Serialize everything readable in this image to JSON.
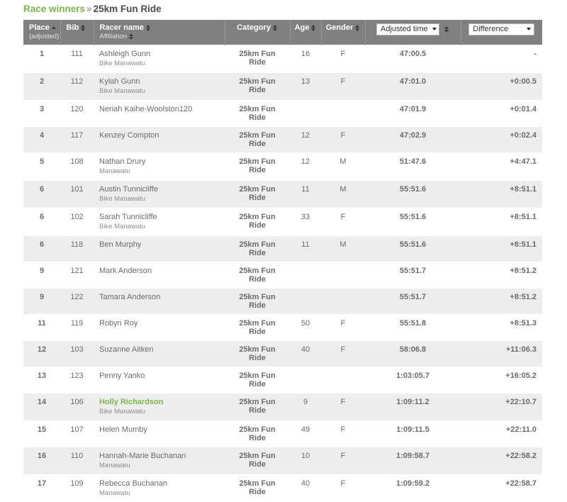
{
  "breadcrumb": {
    "link_label": "Race winners",
    "separator": "»",
    "current_label": "25km Fun Ride"
  },
  "table": {
    "headers": {
      "place": "Place",
      "place_sub": "(adjusted)",
      "bib": "Bib",
      "racer_name": "Racer name",
      "affiliation": "Affiliation",
      "category": "Category",
      "age": "Age",
      "gender": "Gender",
      "adjusted_time_select": "Adjusted time",
      "difference_select": "Difference"
    },
    "sort": {
      "active_column": "place",
      "direction": "asc"
    },
    "rows": [
      {
        "place": "1",
        "bib": "111",
        "name": "Ashleigh Gunn",
        "affiliation": "Bike Manawatu",
        "category": "25km Fun Ride",
        "age": "16",
        "gender": "F",
        "time": "47:00.5",
        "difference": "-",
        "highlight": false
      },
      {
        "place": "2",
        "bib": "112",
        "name": "Kylah Gunn",
        "affiliation": "Bike Manawatu",
        "category": "25km Fun Ride",
        "age": "13",
        "gender": "F",
        "time": "47:01.0",
        "difference": "+0:00.5",
        "highlight": false
      },
      {
        "place": "3",
        "bib": "120",
        "name": "Neriah Kaihe-Woolston120",
        "affiliation": "",
        "category": "25km Fun Ride",
        "age": "",
        "gender": "",
        "time": "47:01.9",
        "difference": "+0:01.4",
        "highlight": false
      },
      {
        "place": "4",
        "bib": "117",
        "name": "Kenzey Compton",
        "affiliation": "",
        "category": "25km Fun Ride",
        "age": "12",
        "gender": "F",
        "time": "47:02.9",
        "difference": "+0:02.4",
        "highlight": false
      },
      {
        "place": "5",
        "bib": "108",
        "name": "Nathan Drury",
        "affiliation": "Manawatu",
        "category": "25km Fun Ride",
        "age": "12",
        "gender": "M",
        "time": "51:47.6",
        "difference": "+4:47.1",
        "highlight": false
      },
      {
        "place": "6",
        "bib": "101",
        "name": "Austin Tunnicliffe",
        "affiliation": "Bike Manawatu",
        "category": "25km Fun Ride",
        "age": "11",
        "gender": "M",
        "time": "55:51.6",
        "difference": "+8:51.1",
        "highlight": false
      },
      {
        "place": "6",
        "bib": "102",
        "name": "Sarah Tunnicliffe",
        "affiliation": "Bike Manawatu",
        "category": "25km Fun Ride",
        "age": "33",
        "gender": "F",
        "time": "55:51.6",
        "difference": "+8:51.1",
        "highlight": false
      },
      {
        "place": "6",
        "bib": "118",
        "name": "Ben Murphy",
        "affiliation": "",
        "category": "25km Fun Ride",
        "age": "11",
        "gender": "M",
        "time": "55:51.6",
        "difference": "+8:51.1",
        "highlight": false
      },
      {
        "place": "9",
        "bib": "121",
        "name": "Mark Anderson",
        "affiliation": "",
        "category": "25km Fun Ride",
        "age": "",
        "gender": "",
        "time": "55:51.7",
        "difference": "+8:51.2",
        "highlight": false
      },
      {
        "place": "9",
        "bib": "122",
        "name": "Tamara Anderson",
        "affiliation": "",
        "category": "25km Fun Ride",
        "age": "",
        "gender": "",
        "time": "55:51.7",
        "difference": "+8:51.2",
        "highlight": false
      },
      {
        "place": "11",
        "bib": "119",
        "name": "Robyn Roy",
        "affiliation": "",
        "category": "25km Fun Ride",
        "age": "50",
        "gender": "F",
        "time": "55:51.8",
        "difference": "+8:51.3",
        "highlight": false
      },
      {
        "place": "12",
        "bib": "103",
        "name": "Suzanne Aitken",
        "affiliation": "",
        "category": "25km Fun Ride",
        "age": "40",
        "gender": "F",
        "time": "58:06.8",
        "difference": "+11:06.3",
        "highlight": false
      },
      {
        "place": "13",
        "bib": "123",
        "name": "Penny Yanko",
        "affiliation": "",
        "category": "25km Fun Ride",
        "age": "",
        "gender": "",
        "time": "1:03:05.7",
        "difference": "+16:05.2",
        "highlight": false
      },
      {
        "place": "14",
        "bib": "106",
        "name": "Holly Richardson",
        "affiliation": "Bike Manawatu",
        "category": "25km Fun Ride",
        "age": "9",
        "gender": "F",
        "time": "1:09:11.2",
        "difference": "+22:10.7",
        "highlight": true
      },
      {
        "place": "15",
        "bib": "107",
        "name": "Helen Mumby",
        "affiliation": "",
        "category": "25km Fun Ride",
        "age": "49",
        "gender": "F",
        "time": "1:09:11.5",
        "difference": "+22:11.0",
        "highlight": false
      },
      {
        "place": "16",
        "bib": "110",
        "name": "Hannah-Marie Buchanan",
        "affiliation": "Manawatu",
        "category": "25km Fun Ride",
        "age": "10",
        "gender": "F",
        "time": "1:09:58.7",
        "difference": "+22:58.2",
        "highlight": false
      },
      {
        "place": "17",
        "bib": "109",
        "name": "Rebecca Buchanan",
        "affiliation": "Manawatu",
        "category": "25km Fun Ride",
        "age": "40",
        "gender": "F",
        "time": "1:09:59.2",
        "difference": "+22:58.7",
        "highlight": false
      }
    ]
  },
  "colors": {
    "accent_green": "#7ab648",
    "header_gray": "#808080",
    "row_alt_gray": "#ededed"
  }
}
